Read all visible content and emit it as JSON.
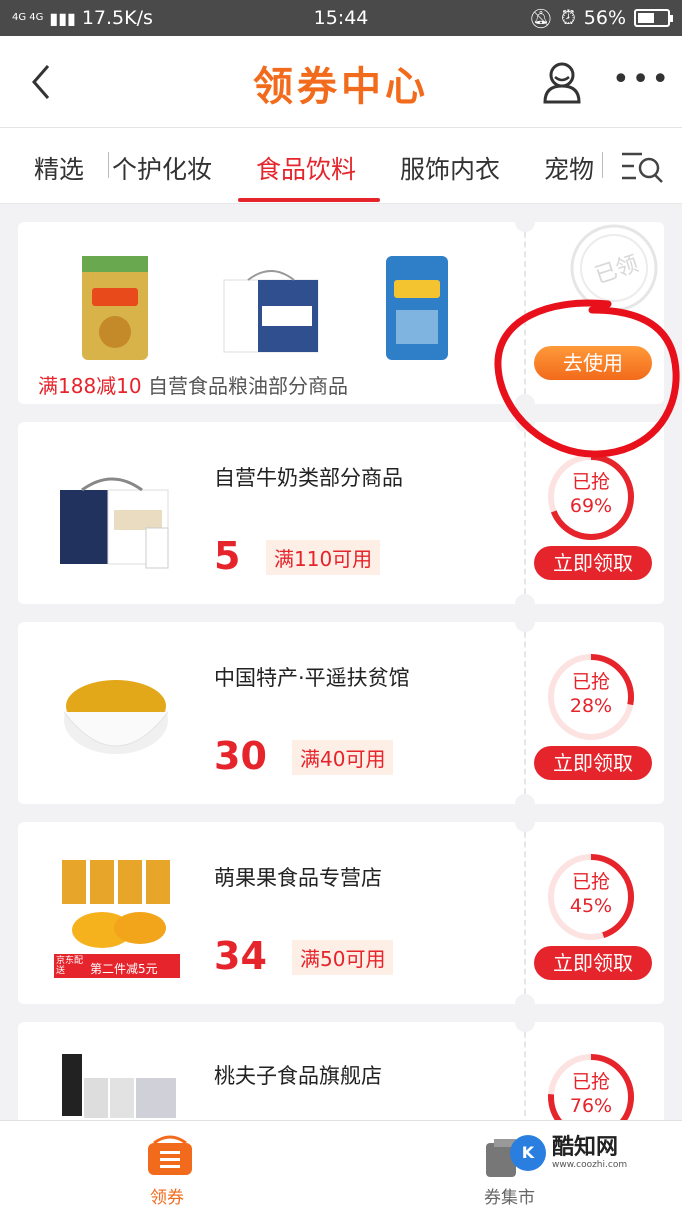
{
  "status_bar": {
    "signal": "4G 4G",
    "speed": "17.5K/s",
    "time": "15:44",
    "battery": "56%",
    "battery_level": 0.56
  },
  "header": {
    "back_icon": "chevron-left-icon",
    "title": "领券中心",
    "user_icon": "user-icon",
    "more_icon": "more-dots-icon",
    "more_label": "•••"
  },
  "tabs": [
    {
      "label": "精选",
      "active": false
    },
    {
      "label": "个护化妆",
      "active": false
    },
    {
      "label": "食品饮料",
      "active": true
    },
    {
      "label": "服饰内衣",
      "active": false
    },
    {
      "label": "宠物",
      "active": false
    }
  ],
  "first_coupon": {
    "discount": "满188减10",
    "scope": "自营食品粮油部分商品",
    "button": "去使用",
    "stamp": "已领"
  },
  "coupons": [
    {
      "shop": "自营牛奶类部分商品",
      "amount": "5",
      "condition": "满110可用",
      "claimed_label": "已抢",
      "claimed_pct": "69%",
      "claimed": 0.69,
      "button": "立即领取"
    },
    {
      "shop": "中国特产·平遥扶贫馆",
      "amount": "30",
      "condition": "满40可用",
      "claimed_label": "已抢",
      "claimed_pct": "28%",
      "claimed": 0.28,
      "button": "立即领取"
    },
    {
      "shop": "萌果果食品专营店",
      "amount": "34",
      "condition": "满50可用",
      "claimed_label": "已抢",
      "claimed_pct": "45%",
      "claimed": 0.45,
      "button": "立即领取",
      "thumb_badge_a": "京东配送",
      "thumb_badge_b": "第二件减5元"
    },
    {
      "shop": "桃夫子食品旗舰店",
      "claimed_label": "已抢",
      "claimed_pct": "76%",
      "claimed": 0.76
    }
  ],
  "bottom_nav": {
    "left_label": "领券",
    "right_label": "券集市"
  },
  "watermark": {
    "name": "酷知网",
    "url": "www.coozhi.com",
    "mark": "K"
  },
  "colors": {
    "accent_red": "#e5242b",
    "accent_orange": "#f26a1b",
    "annotation": "#e8101a"
  }
}
